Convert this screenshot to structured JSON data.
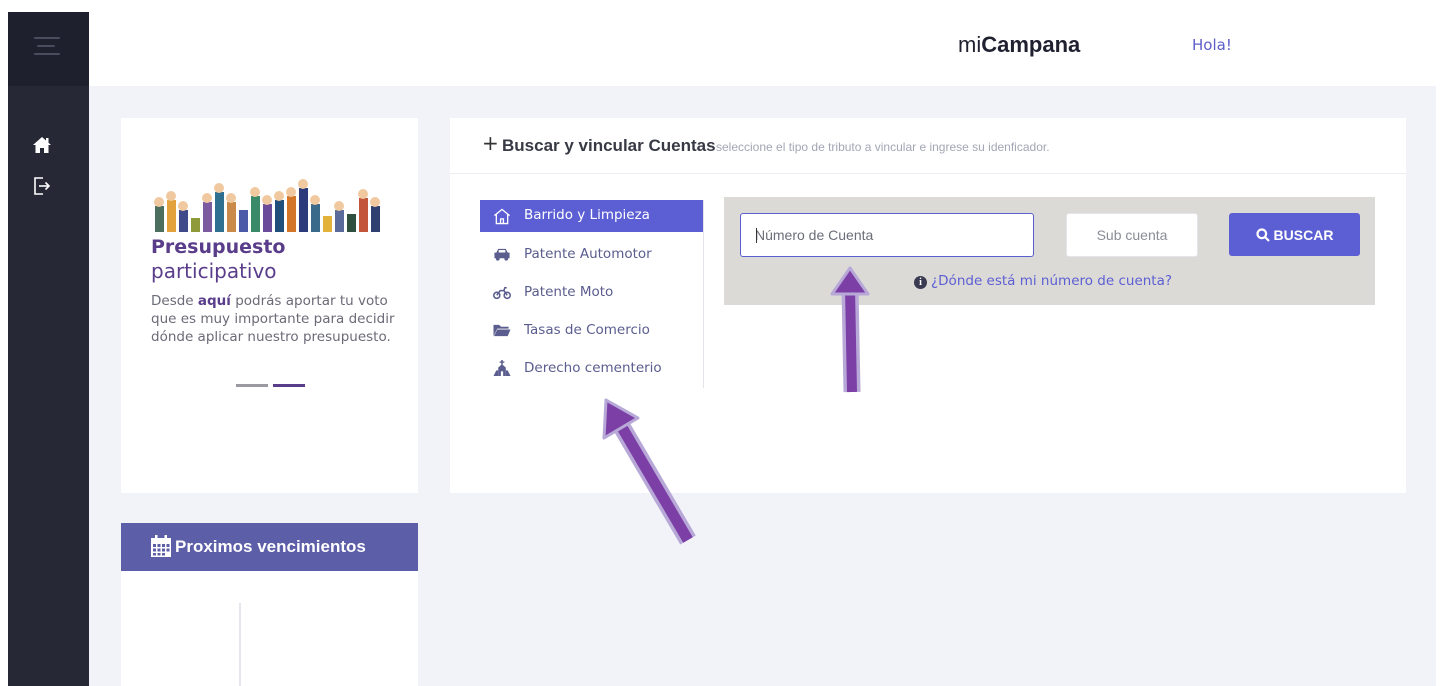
{
  "header": {
    "brand_prefix": "mi",
    "brand_bold": "Campana",
    "greeting": "Hola!"
  },
  "sidebar": {
    "items": [
      {
        "icon": "home-icon"
      },
      {
        "icon": "logout-icon"
      }
    ]
  },
  "promo": {
    "title_line1": "Presupuesto",
    "title_line2": "participativo",
    "text_before": "Desde ",
    "text_bold": "aquí",
    "text_after": " podrás aportar tu voto que es muy importante para decidir dónde aplicar nuestro presupuesto.",
    "slides": 2,
    "active_slide": 2
  },
  "vencimientos": {
    "title": "Proximos vencimientos"
  },
  "search": {
    "plus": "+",
    "title": "Buscar y vincular Cuentas",
    "subtitle": "seleccione el tipo de tributo a vincular e ingrese su idenficador.",
    "tabs": [
      {
        "label": "Barrido y Limpieza",
        "icon": "house-icon",
        "active": true
      },
      {
        "label": "Patente Automotor",
        "icon": "car-icon",
        "active": false
      },
      {
        "label": "Patente Moto",
        "icon": "motorcycle-icon",
        "active": false
      },
      {
        "label": "Tasas de Comercio",
        "icon": "folder-icon",
        "active": false
      },
      {
        "label": "Derecho cementerio",
        "icon": "church-icon",
        "active": false
      }
    ],
    "account_placeholder": "Número de Cuenta",
    "subaccount_placeholder": "Sub cuenta",
    "button_label": "BUSCAR",
    "help_text": "¿Dónde está mi número de cuenta?"
  },
  "colors": {
    "accent": "#5c5fd4",
    "sidebar": "#272836",
    "promo_title": "#5a3d8a",
    "annotation_arrow": "#7b3fa6"
  }
}
